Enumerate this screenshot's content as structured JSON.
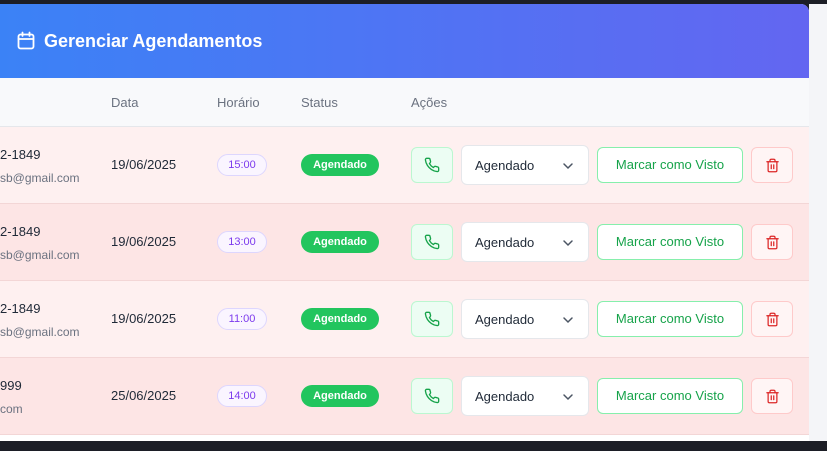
{
  "header": {
    "title": "Gerenciar Agendamentos",
    "icon": "calendar-icon"
  },
  "table": {
    "columns": {
      "date": "Data",
      "time": "Horário",
      "status": "Status",
      "actions": "Ações"
    },
    "rows": [
      {
        "phone": "2-1849",
        "email": "sb@gmail.com",
        "date": "19/06/2025",
        "time": "15:00",
        "status": "Agendado",
        "select_value": "Agendado",
        "mark_label": "Marcar como Visto"
      },
      {
        "phone": "2-1849",
        "email": "sb@gmail.com",
        "date": "19/06/2025",
        "time": "13:00",
        "status": "Agendado",
        "select_value": "Agendado",
        "mark_label": "Marcar como Visto"
      },
      {
        "phone": "2-1849",
        "email": "sb@gmail.com",
        "date": "19/06/2025",
        "time": "11:00",
        "status": "Agendado",
        "select_value": "Agendado",
        "mark_label": "Marcar como Visto"
      },
      {
        "phone": "999",
        "email": "com",
        "date": "25/06/2025",
        "time": "14:00",
        "status": "Agendado",
        "select_value": "Agendado",
        "mark_label": "Marcar como Visto"
      }
    ]
  },
  "colors": {
    "header_start": "#3b82f6",
    "header_end": "#6366f1",
    "status_green": "#22c55e",
    "accent_green": "#16a34a",
    "delete_red": "#dc2626",
    "time_purple": "#7c3aed"
  }
}
